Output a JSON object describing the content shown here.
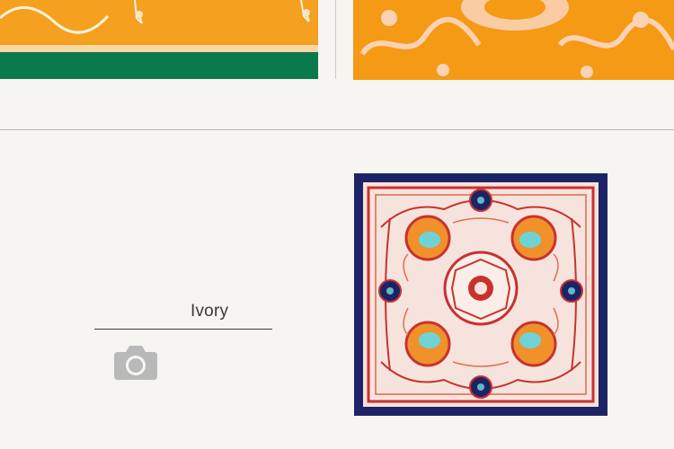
{
  "product": {
    "color_label": "Ivory"
  },
  "icons": {
    "camera": "camera-icon"
  },
  "colors": {
    "background": "#f6f5f2",
    "scarf_border": "#1d2466",
    "scarf_field": "#f7e3dd",
    "ornament_red": "#c8322e",
    "accent_orange": "#f0912b",
    "accent_teal": "#6fd3d6",
    "thumb_orange": "#f5a01e",
    "thumb_green": "#0b7a4a"
  }
}
